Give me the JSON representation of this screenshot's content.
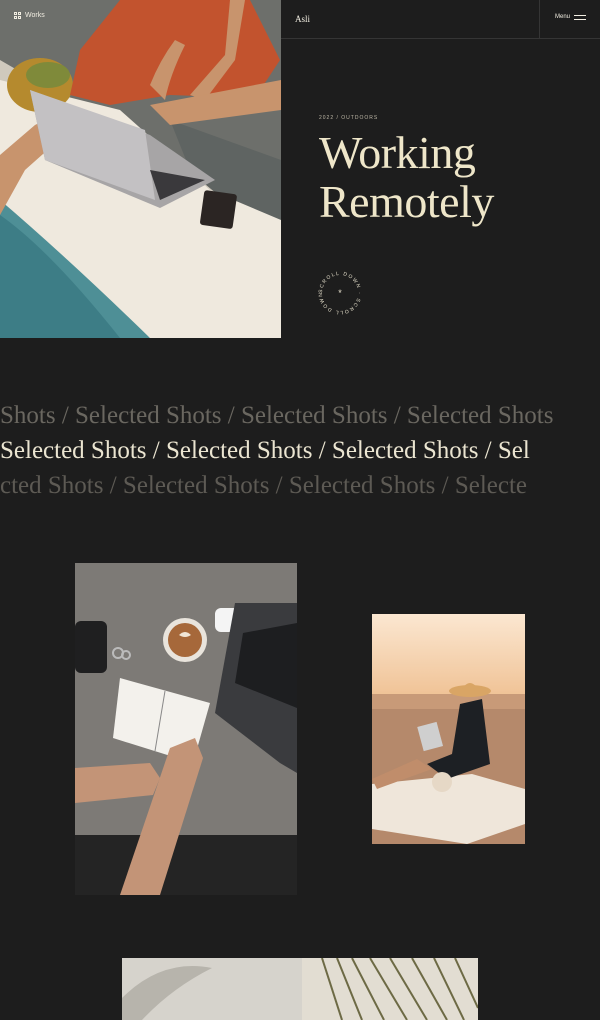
{
  "header": {
    "works_label": "Works",
    "brand": "Asli",
    "menu_label": "Menu"
  },
  "hero": {
    "meta": "2022  /  OUTDOORS",
    "title_line1": "Working",
    "title_line2": "Remotely",
    "scroll_badge_text": "SCROLL DOWN · SCROLL DOWN · "
  },
  "marquee": {
    "row1": "Shots  /  Selected Shots  /  Selected Shots  /  Selected Shots",
    "row2": "Selected Shots  /  Selected Shots  /  Selected Shots  /  Sel",
    "row3": "cted Shots  /  Selected Shots  /  Selected Shots  /  Selecte"
  },
  "colors": {
    "background": "#1d1d1d",
    "accent_text": "#eee6c9"
  },
  "icons": [
    "grid-icon",
    "hamburger-icon",
    "asterisk-icon"
  ]
}
